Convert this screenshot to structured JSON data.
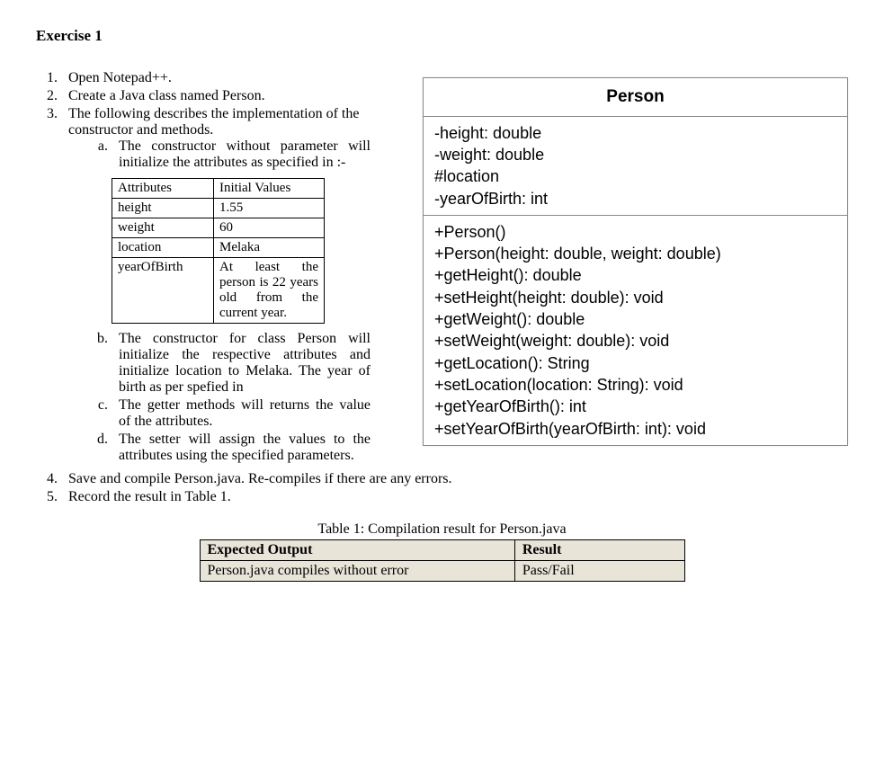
{
  "title": "Exercise 1",
  "steps": {
    "s1": "Open Notepad++.",
    "s2": "Create a Java class named Person.",
    "s3": "The following describes the implementation of the constructor and methods.",
    "s3a": "The constructor without parameter will initialize the attributes as specified in :-",
    "s3b": "The constructor for class Person will initialize the respective attributes and initialize location to Melaka.  The year of birth as per spefied in",
    "s3c": "The getter methods will returns the value of the attributes.",
    "s3d": "The setter will assign the values to the attributes using the specified parameters.",
    "s4": "Save and compile Person.java.  Re-compiles if there are any errors.",
    "s5": "Record the result in Table 1."
  },
  "attr_table": {
    "h1": "Attributes",
    "h2": "Initial Values",
    "rows": [
      {
        "attr": "height",
        "val": "1.55"
      },
      {
        "attr": "weight",
        "val": "60"
      },
      {
        "attr": "location",
        "val": "Melaka"
      },
      {
        "attr": "yearOfBirth",
        "val": "At least the person is 22 years old from the current year."
      }
    ]
  },
  "uml": {
    "title": "Person",
    "attributes": [
      "-height: double",
      "-weight: double",
      "#location",
      "-yearOfBirth: int"
    ],
    "methods": [
      "+Person()",
      "+Person(height: double, weight: double)",
      "+getHeight(): double",
      "+setHeight(height: double): void",
      "+getWeight(): double",
      "+setWeight(weight: double): void",
      "+getLocation(): String",
      "+setLocation(location: String): void",
      "+getYearOfBirth(): int",
      "+setYearOfBirth(yearOfBirth: int): void"
    ]
  },
  "table1": {
    "caption": "Table 1: Compilation result for Person.java",
    "h1": "Expected Output",
    "h2": "Result",
    "r1c1": "Person.java compiles without error",
    "r1c2": "Pass/Fail"
  }
}
